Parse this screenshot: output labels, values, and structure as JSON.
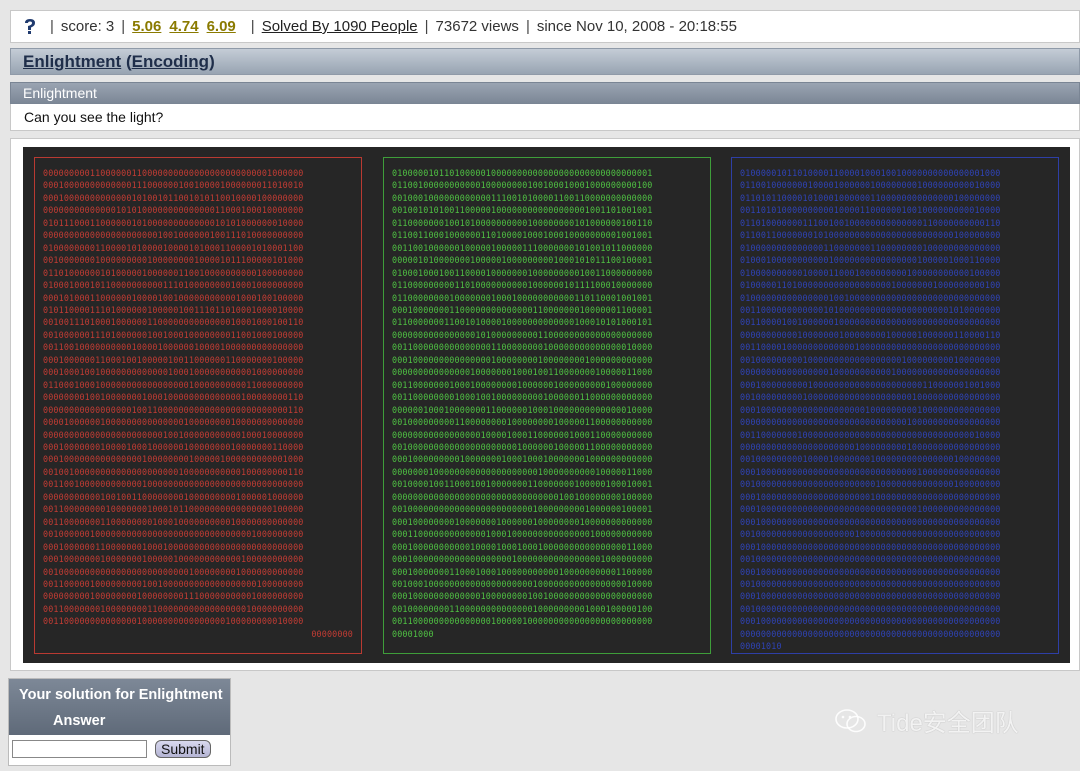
{
  "stats": {
    "score": "score: 3",
    "ratings": [
      "5.06",
      "4.74",
      "6.09"
    ],
    "solved": "Solved By 1090 People",
    "views": "73672 views",
    "since": "since Nov 10, 2008 - 20:18:55"
  },
  "title": {
    "name": "Enlightment",
    "category": "Encoding"
  },
  "challenge": {
    "header": "Enlightment",
    "description": "Can you see the light?"
  },
  "binary": {
    "red": [
      "00000000011000000110000000000000000000000001000000",
      "00010000000000000111000000100100001000000011010010",
      "00010000000000000101001011001010110010000100000000",
      "00000000000000101010000000000000011000100010000000",
      "01011100011000000101000000000000010101000000010000",
      "00000000000000000000001001000000100111010000000000",
      "01000000001100001010000100001010001100001010001100",
      "00100000001000000000100000000100001011100000101000",
      "01101000000101000001000000110010000000000100000000",
      "01000100010110000000000111010000000010001000000000",
      "00010100011000000100001001000000000001000100100000",
      "01011000011101000000100000100111011010001000010000",
      "00100111010001000000110000000000000010001000100110",
      "00100000011101000000100100010000000011001000100000",
      "00110010000000000100001000000100001000000000000000",
      "00010000001100010010000010011000000110000000100000",
      "00010001001000000000000010001000000000001000000000",
      "01100010001000000000000000001000000000011000000000",
      "00000000100100000001000100000000000000100000000110",
      "00000000000000000100110000000000000000000000000110",
      "00001000000100000000000000010000000010000000000000",
      "00000000000000000000000100100000000000100010000000",
      "00010000000100001000100000010000000010000000110000",
      "00010000000000000001000000001000001000000000001000",
      "00100100000000000000000000100000000000100000000110",
      "00110010000000000001000000000000000000000000000000",
      "00000000000100100110000000010000000001000001000000",
      "00110000000010000000100010110000000000000000100000",
      "00110000000110000000010001000000000010000000000000",
      "00100000010000000000000000000000000000001000000000",
      "00010000001100000001000100000000000000000000000000",
      "00010000000100000001000001000000000000100000000000",
      "00100000000000000000000000001000000001000000000000",
      "00110000010000000001001000000000000000000100000000",
      "00000000010000000010000000011100000000001000000000",
      "00110000000100000000110000000000000000010000000000",
      "00110000000000000010000000000000000100000000010000",
      "00000000"
    ],
    "green": [
      "01000001011010000010000000000000000000000000000001",
      "01100100000000000100000000100100010001000000000100",
      "00100010000000000001110010100001100110000000000000",
      "00100101010011000001000000000000000001001101001001",
      "01100000001001010000000000100000000101000000100110",
      "01100110001000000110100001000100010000000001001001",
      "00110010000001000001000001110000000101001011000000",
      "00000101000000010000010000000001000101011100100001",
      "01000100010011000010000000100000000010011000000000",
      "01100000000011010000000000100000010111100010000000",
      "01100000000100000001000100000000000110110001001001",
      "00010000000110000000000000011000000010000001100001",
      "01100000001100101000010000000000000100010101000101",
      "00000000000000001010000000001100000000000000000000",
      "00110000000000000001100000000100000000000000010000",
      "00010000000000000001000000001000000001000000000000",
      "00000000000000010000000100010011000000010000011000",
      "00110000000100010000000010000001000000000100000000",
      "00110000000010001001000000000100000011000000000000",
      "00000010001000000011000000100010000000000000010000",
      "00100000000011000000001000000001000001100000000000",
      "00000000000000000100001000110000001000110000000000",
      "00100000000000000000000010000001000001100000000000",
      "00010000000001000000010001000100000001000000000000",
      "00000001000000000000000000001000000000010000011000",
      "00100001001100010010000000110000000100000100010001",
      "00000000000000000000000000000000100100000000100000",
      "00100000000000000000000000010000000001000000100001",
      "00010000000010000000100000010000000010000000000000",
      "00011000000000000010001000000000000000100000000000",
      "00010000000000010000100010001000000000000000011000",
      "00010000000000000000000100000000000000001000000000",
      "00010000000110001000100000000000100000000001100000",
      "00100010000000000000000000010000000000000000010000",
      "00010000000000000100000000100100000000000000000000",
      "00100000000110000000000000010000000001000100000100",
      "00110000000000000001000001000000000000000000000000",
      "00001000"
    ],
    "blue": [
      "01000001011010000110000100010010000000000000001000",
      "01100100000001000010000001000000001000000000010000",
      "01101011000010100010000001100000000000000100000000",
      "00110101000000000010000110000001001000000000010000",
      "01101000000011100100100000000000000110000000000110",
      "01100110000000101000000000000000000000000100000000",
      "01000000000000001100000001100000000100000000000000",
      "01000100000000000100000000000000001000001000110000",
      "01000000000010000110001000000000100000000000100000",
      "01000001101000000000000000000100000001000000000100",
      "01000000000000000100100000000000000000000000000000",
      "00110000000000001010000000000000000000001010000000",
      "00110000100100000010000000000000000000000000000000",
      "00000000000100000001000000001000001000000110000110",
      "00110000100000000000001000000000000000000000000000",
      "00100000000010000000000000000001000000000100000000",
      "00000000000000000100000000000100000000000000000000",
      "00010000000001000000000000000000000110000001001000",
      "00100000000010000000000000000000010000000000000000",
      "00010000000000000000000010000000001000000000000000",
      "00000000000000000000000000000000100000000000000000",
      "00110000000100000000000000000000000000000000010000",
      "00000000000000000000001000000000100000000000000000",
      "00100000000010000100000001000000000000000100000000",
      "00010000000000000000000000000000001000000000000000",
      "00100000000000000000000000100000000000000100000000",
      "00010000000000000000000001000000000000000000000000",
      "00010000000000000000000000000000001000000000000000",
      "00010000000000000000000000000000000000000000000000",
      "00100000000000000000001000000000000000000000000000",
      "00010000000000000000000000000000000000000000000000",
      "00100000000000000000000000000000000000000000000000",
      "00010000000000000000000000000000000000000000000000",
      "00100000000000000000000000000000000000000000000000",
      "00010000000000000000000000000000000000000000000000",
      "00100000000000000000000000000000000000000000000000",
      "00010000000000000000000000000000000000000000000000",
      "00000000000000000000000000000000000000000000000000",
      "00001010"
    ]
  },
  "solution": {
    "heading": "Your solution for Enlightment",
    "answer_label": "Answer",
    "input_value": "",
    "submit_label": "Submit"
  },
  "watermark": {
    "text": "Tide安全团队"
  }
}
